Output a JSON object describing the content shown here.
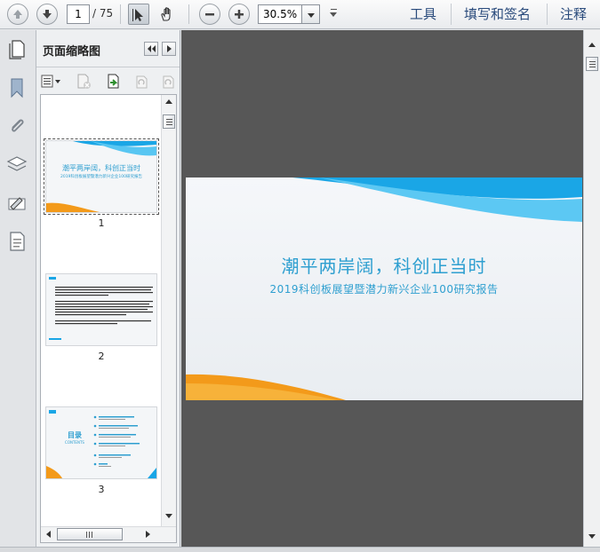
{
  "toolbar": {
    "current_page": "1",
    "total_pages": "/ 75",
    "zoom": "30.5%",
    "tools_label": "工具",
    "fill_sign_label": "填写和签名",
    "comment_label": "注释"
  },
  "panel": {
    "title": "页面缩略图",
    "thumbnails": [
      {
        "number": "1",
        "title": "潮平两岸阔，科创正当时",
        "subtitle": "2019科创板展望暨潜力新兴企业100研究报告"
      },
      {
        "number": "2"
      },
      {
        "number": "3",
        "toc_title": "目录",
        "toc_sub": "CONTENTS"
      }
    ]
  },
  "document": {
    "title": "潮平两岸阔，科创正当时",
    "subtitle": "2019科创板展望暨潜力新兴企业100研究报告"
  },
  "colors": {
    "accent_blue": "#2e9fd0",
    "accent_orange": "#f39a1a",
    "menu_text": "#2a4b7c",
    "doc_background": "#575757"
  }
}
